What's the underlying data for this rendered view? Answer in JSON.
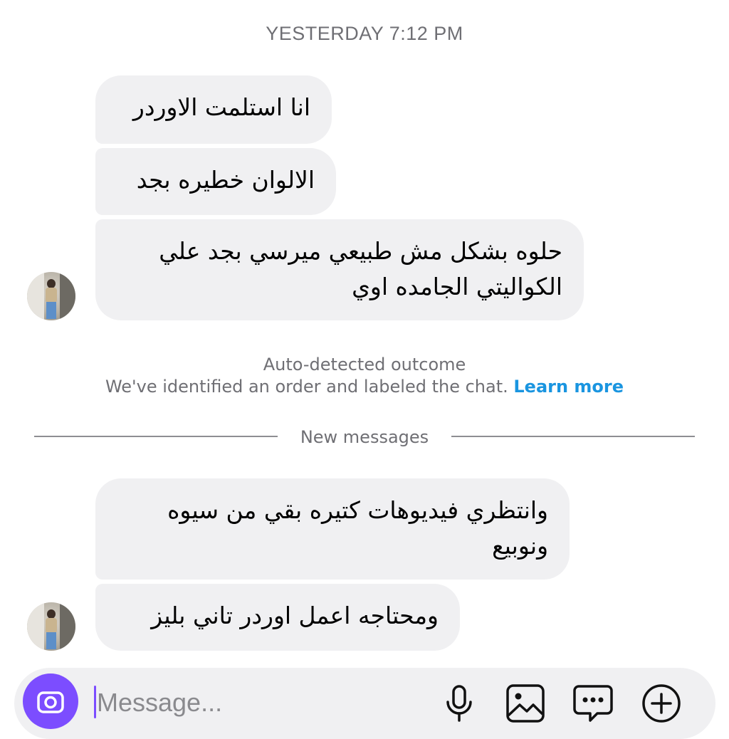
{
  "chat": {
    "timestamp": "YESTERDAY 7:12 PM",
    "group1": [
      {
        "lines": [
          "انا استلمت الاوردر"
        ]
      },
      {
        "lines": [
          "الالوان خطيره بجد"
        ]
      },
      {
        "lines": [
          "حلوه بشكل مش طبيعي ميرسي بجد علي",
          "الكواليتي الجامده اوي"
        ]
      }
    ],
    "notice": {
      "title": "Auto-detected outcome",
      "body": "We've identified an order and labeled the chat.",
      "link": "Learn more"
    },
    "divider": "New messages",
    "group2": [
      {
        "lines": [
          "وانتظري فيديوهات كتيره بقي من سيوه",
          "ونوبيع"
        ]
      },
      {
        "lines": [
          "ومحتاجه اعمل اوردر تاني بليز"
        ]
      }
    ]
  },
  "composer": {
    "placeholder": "Message...",
    "icons": [
      "camera-icon",
      "microphone-icon",
      "image-icon",
      "sticker-icon",
      "plus-icon"
    ],
    "accent": "#7c4dff"
  },
  "colors": {
    "bubble": "#f0f0f2",
    "link": "#1a95e0",
    "muted": "#6f6f74"
  }
}
